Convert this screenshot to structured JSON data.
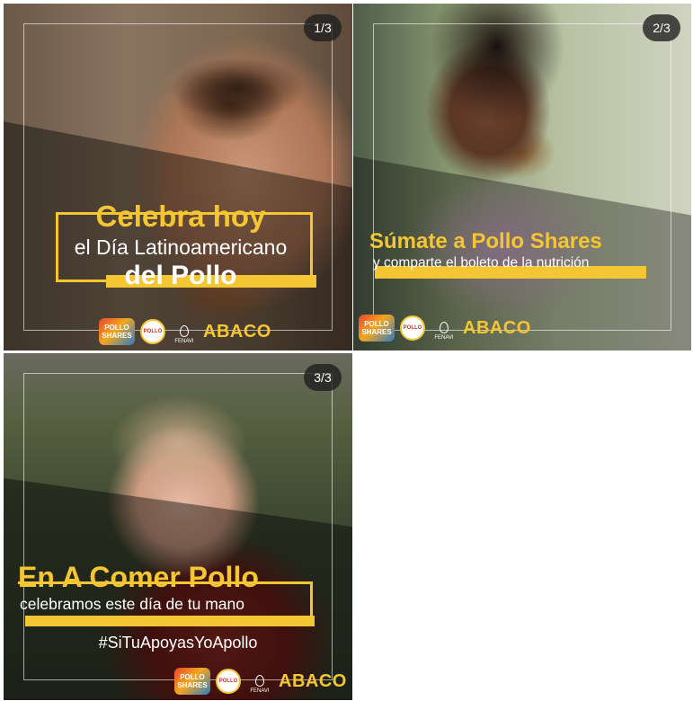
{
  "cards": [
    {
      "counter": "1/3",
      "line1": "Celebra hoy",
      "line2": "el Día Latinoamericano",
      "line3": "del Pollo"
    },
    {
      "counter": "2/3",
      "line1": "Súmate a Pollo Shares",
      "line2": "y comparte el boleto de la nutrición"
    },
    {
      "counter": "3/3",
      "line1": "En A Comer Pollo",
      "line2": "celebramos este día de tu mano",
      "hashtag": "#SiTuApoyasYoApollo"
    }
  ],
  "logos": {
    "pollo_shares": "POLLO SHARES",
    "pollo": "POLLO",
    "fenavi": "FENAVI",
    "abaco": "ABACO"
  },
  "colors": {
    "accent_yellow": "#f4c633",
    "counter_bg": "#1e1e1e"
  }
}
